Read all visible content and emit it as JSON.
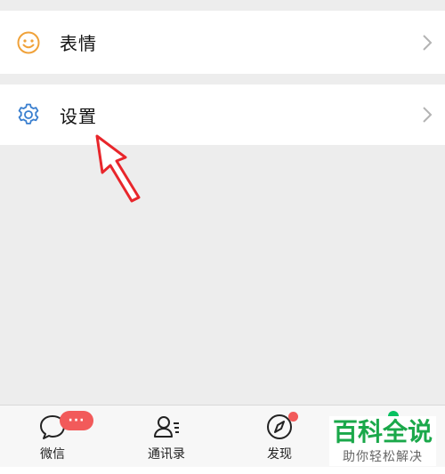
{
  "menu": {
    "emoji": {
      "label": "表情",
      "icon": "smile-icon"
    },
    "settings": {
      "label": "设置",
      "icon": "gear-icon"
    }
  },
  "tabbar": {
    "tabs": [
      {
        "label": "微信",
        "icon": "chat-bubble-icon"
      },
      {
        "label": "通讯录",
        "icon": "contacts-icon"
      },
      {
        "label": "发现",
        "icon": "compass-icon"
      }
    ],
    "chats_badge": "···"
  },
  "watermark": {
    "title": "百科全说",
    "subtitle": "助你轻松解决"
  },
  "colors": {
    "accent_orange": "#f0a23a",
    "accent_blue": "#3a7fcf",
    "badge_red": "#f25a5a",
    "watermark_green": "#1aa84a",
    "pointer_red": "#e8262b"
  }
}
